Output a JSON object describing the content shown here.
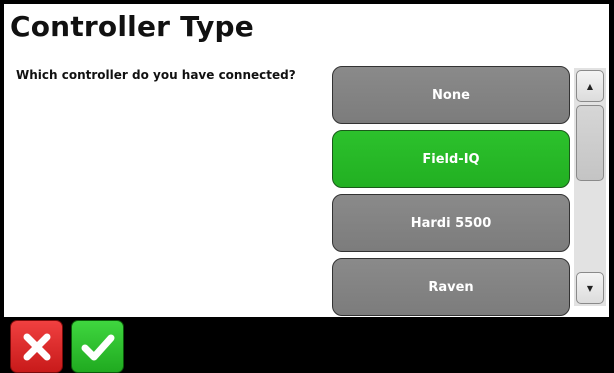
{
  "page": {
    "title": "Controller Type",
    "question": "Which controller do you have connected?"
  },
  "options": [
    {
      "label": "None",
      "selected": false
    },
    {
      "label": "Field-IQ",
      "selected": true
    },
    {
      "label": "Hardi 5500",
      "selected": false
    },
    {
      "label": "Raven",
      "selected": false
    }
  ],
  "scrollbar": {
    "up_icon": "triangle-up",
    "down_icon": "triangle-down"
  },
  "footer": {
    "cancel_icon": "x-icon",
    "confirm_icon": "check-icon"
  },
  "colors": {
    "selected_option": "#22b022",
    "option": "#808080",
    "cancel": "#d82020",
    "confirm": "#2cc12c"
  }
}
